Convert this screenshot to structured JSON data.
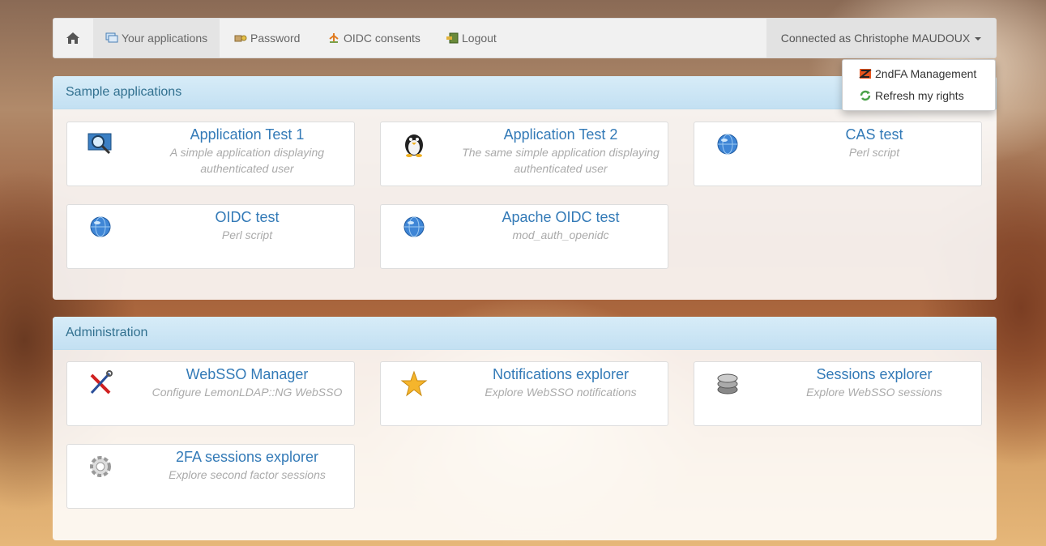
{
  "navbar": {
    "home_icon": "home-icon",
    "links": [
      {
        "label": "Your applications",
        "icon": "apps-icon"
      },
      {
        "label": "Password",
        "icon": "key-icon"
      },
      {
        "label": "OIDC consents",
        "icon": "consent-icon"
      },
      {
        "label": "Logout",
        "icon": "logout-icon"
      }
    ],
    "user_label": "Connected as Christophe MAUDOUX"
  },
  "dropdown": {
    "items": [
      {
        "label": "2ndFA Management",
        "icon": "2fa-icon"
      },
      {
        "label": "Refresh my rights",
        "icon": "refresh-icon"
      }
    ]
  },
  "categories": [
    {
      "title": "Sample applications",
      "apps": [
        {
          "name": "Application Test 1",
          "desc": "A simple application displaying authenticated user",
          "icon": "magnifier-screen-icon"
        },
        {
          "name": "Application Test 2",
          "desc": "The same simple application displaying authenticated user",
          "icon": "penguin-icon"
        },
        {
          "name": "CAS test",
          "desc": "Perl script",
          "icon": "globe-icon"
        },
        {
          "name": "OIDC test",
          "desc": "Perl script",
          "icon": "globe-icon"
        },
        {
          "name": "Apache OIDC test",
          "desc": "mod_auth_openidc",
          "icon": "globe-icon"
        }
      ]
    },
    {
      "title": "Administration",
      "apps": [
        {
          "name": "WebSSO Manager",
          "desc": "Configure LemonLDAP::NG WebSSO",
          "icon": "tools-icon"
        },
        {
          "name": "Notifications explorer",
          "desc": "Explore WebSSO notifications",
          "icon": "star-icon"
        },
        {
          "name": "Sessions explorer",
          "desc": "Explore WebSSO sessions",
          "icon": "database-icon"
        },
        {
          "name": "2FA sessions explorer",
          "desc": "Explore second factor sessions",
          "icon": "gear-icon"
        }
      ]
    }
  ]
}
